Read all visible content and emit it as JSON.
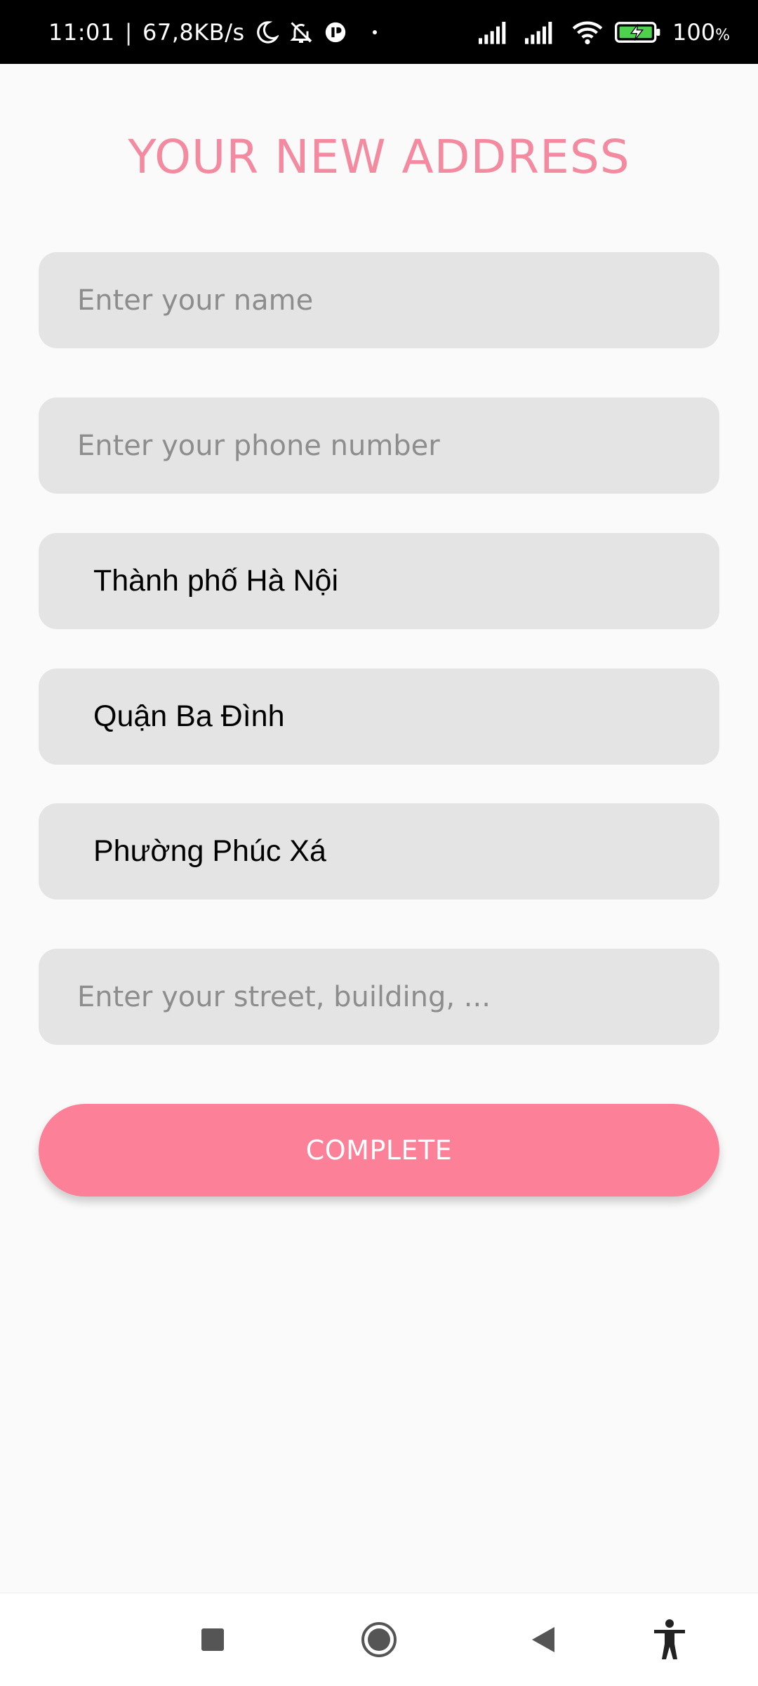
{
  "status_bar": {
    "time": "11:01",
    "separator": "|",
    "speed": "67,8KB/s",
    "battery": "100",
    "battery_unit": "%",
    "icons": [
      "moon-icon",
      "bell-off-icon",
      "app-notification-icon",
      "signal-icon",
      "signal-icon",
      "wifi-icon",
      "battery-charging-icon"
    ]
  },
  "page": {
    "title": "YOUR NEW ADDRESS"
  },
  "form": {
    "name": {
      "placeholder": "Enter your name",
      "value": ""
    },
    "phone": {
      "placeholder": "Enter your phone number",
      "value": ""
    },
    "city": {
      "value": "Thành phố Hà Nội"
    },
    "district": {
      "value": "Quận Ba Đình"
    },
    "ward": {
      "value": "Phường Phúc Xá"
    },
    "street": {
      "placeholder": "Enter your street, building, ...",
      "value": ""
    }
  },
  "actions": {
    "complete_label": "COMPLETE"
  },
  "nav_bar": {
    "icons": [
      "square-icon",
      "home-circle-icon",
      "back-triangle-icon",
      "accessibility-icon"
    ]
  },
  "colors": {
    "accent": "#f48aa0",
    "button": "#fc8198",
    "field_bg": "#e4e4e4",
    "page_bg": "#fafafa"
  }
}
